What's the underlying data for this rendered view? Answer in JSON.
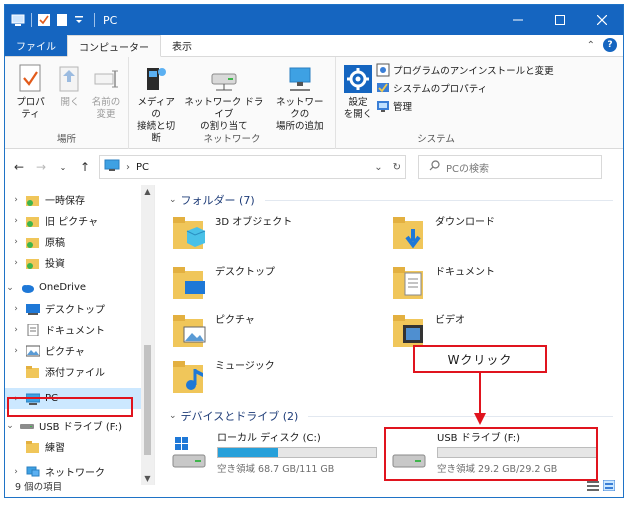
{
  "window": {
    "title": "PC"
  },
  "tabs": {
    "file": "ファイル",
    "computer": "コンピューター",
    "view": "表示"
  },
  "ribbon": {
    "location": {
      "label": "場所",
      "properties": "プロパティ",
      "open": "開く",
      "rename_line1": "名前の",
      "rename_line2": "変更"
    },
    "network": {
      "label": "ネットワーク",
      "media_line1": "メディアの",
      "media_line2": "接続と切断",
      "map_drive_line1": "ネットワーク ドライブ",
      "map_drive_line2": "の割り当て",
      "add_location_line1": "ネットワークの",
      "add_location_line2": "場所の追加"
    },
    "system": {
      "label": "システム",
      "settings_line1": "設定",
      "settings_line2": "を開く",
      "uninstall": "プログラムのアンインストールと変更",
      "system_props": "システムのプロパティ",
      "manage": "管理"
    }
  },
  "address": {
    "path": "PC",
    "search_placeholder": "PCの検索"
  },
  "nav": {
    "items": [
      {
        "label": "一時保存"
      },
      {
        "label": "旧 ピクチャ"
      },
      {
        "label": "原稿"
      },
      {
        "label": "投資"
      },
      {
        "label": "OneDrive"
      },
      {
        "label": "デスクトップ"
      },
      {
        "label": "ドキュメント"
      },
      {
        "label": "ピクチャ"
      },
      {
        "label": "添付ファイル"
      },
      {
        "label": "PC"
      },
      {
        "label": "USB ドライブ (F:)"
      },
      {
        "label": "練習"
      },
      {
        "label": "ネットワーク"
      }
    ]
  },
  "folders": {
    "header": "フォルダー (7)",
    "items": [
      {
        "label": "3D オブジェクト"
      },
      {
        "label": "ダウンロード"
      },
      {
        "label": "デスクトップ"
      },
      {
        "label": "ドキュメント"
      },
      {
        "label": "ピクチャ"
      },
      {
        "label": "ビデオ"
      },
      {
        "label": "ミュージック"
      }
    ]
  },
  "devices": {
    "header": "デバイスとドライブ (2)",
    "drives": [
      {
        "name": "ローカル ディスク (C:)",
        "free_text": "空き領域 68.7 GB/111 GB",
        "used_fraction": 0.38
      },
      {
        "name": "USB ドライブ (F:)",
        "free_text": "空き領域 29.2 GB/29.2 GB",
        "used_fraction": 0.0
      }
    ]
  },
  "annotation": {
    "callout": "Wクリック"
  },
  "status": {
    "count": "9 個の項目"
  },
  "colors": {
    "accent": "#1565c0",
    "highlight": "#e0141e",
    "drive_bar": "#26a0da"
  }
}
